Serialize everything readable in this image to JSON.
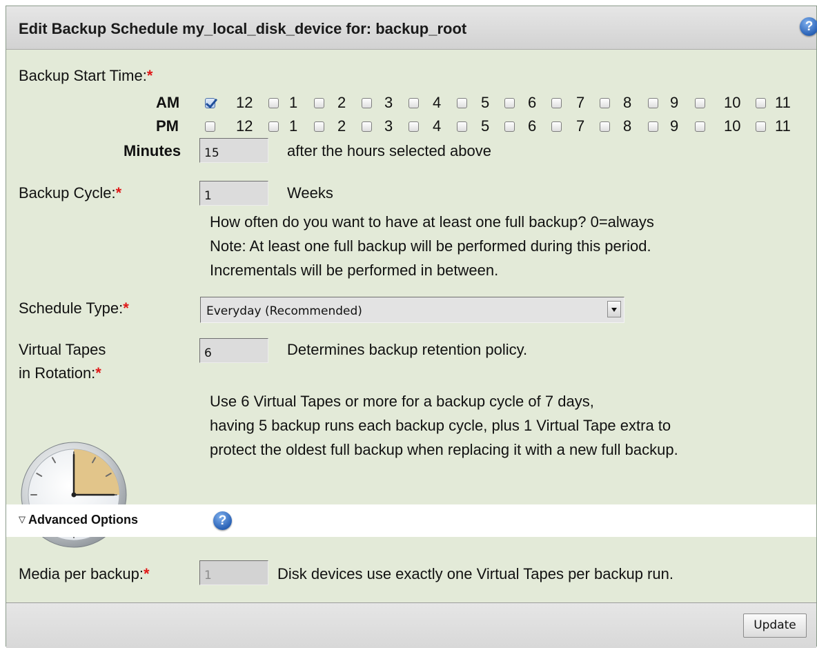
{
  "header": {
    "title": "Edit Backup Schedule my_local_disk_device for: backup_root",
    "help": "?"
  },
  "start_time": {
    "label": "Backup Start Time:",
    "required_mark": "*",
    "am_label": "AM",
    "pm_label": "PM",
    "hours": [
      "12",
      "1",
      "2",
      "3",
      "4",
      "5",
      "6",
      "7",
      "8",
      "9",
      "10",
      "11"
    ],
    "am_checked": [
      true,
      false,
      false,
      false,
      false,
      false,
      false,
      false,
      false,
      false,
      false,
      false
    ],
    "pm_checked": [
      false,
      false,
      false,
      false,
      false,
      false,
      false,
      false,
      false,
      false,
      false,
      false
    ],
    "minutes_label": "Minutes",
    "minutes_value": "15",
    "minutes_suffix": "after the hours selected above"
  },
  "cycle": {
    "label": "Backup Cycle:",
    "required_mark": "*",
    "value": "1",
    "unit": "Weeks",
    "help_lines": [
      "How often do you want to have at least one full backup? 0=always",
      "Note: At least one full backup will be performed during this period.",
      "Incrementals will be performed in between."
    ]
  },
  "schedule_type": {
    "label": "Schedule Type:",
    "required_mark": "*",
    "selected": "Everyday (Recommended)"
  },
  "tapes": {
    "label_line1": "Virtual Tapes",
    "label_line2": "in Rotation:",
    "required_mark": "*",
    "value": "6",
    "suffix": "Determines backup retention policy.",
    "help_lines": [
      "Use 6 Virtual Tapes or more for a backup cycle of 7 days,",
      "having 5 backup runs each backup cycle, plus 1 Virtual Tape extra to",
      "protect the oldest full backup when replacing it with a new full backup."
    ],
    "clock_icon": "clock-icon"
  },
  "advanced": {
    "toggle_icon": "▽",
    "label": "Advanced Options",
    "help": "?"
  },
  "media": {
    "label": "Media per backup:",
    "required_mark": "*",
    "value": "1",
    "suffix": "Disk devices use exactly one Virtual Tapes per backup run."
  },
  "footer": {
    "update_label": "Update"
  },
  "colors": {
    "panel_bg": "#e3ead8",
    "header_bg": "#d8d8d8",
    "required": "#e01818",
    "help_icon": "#2a62b6"
  }
}
